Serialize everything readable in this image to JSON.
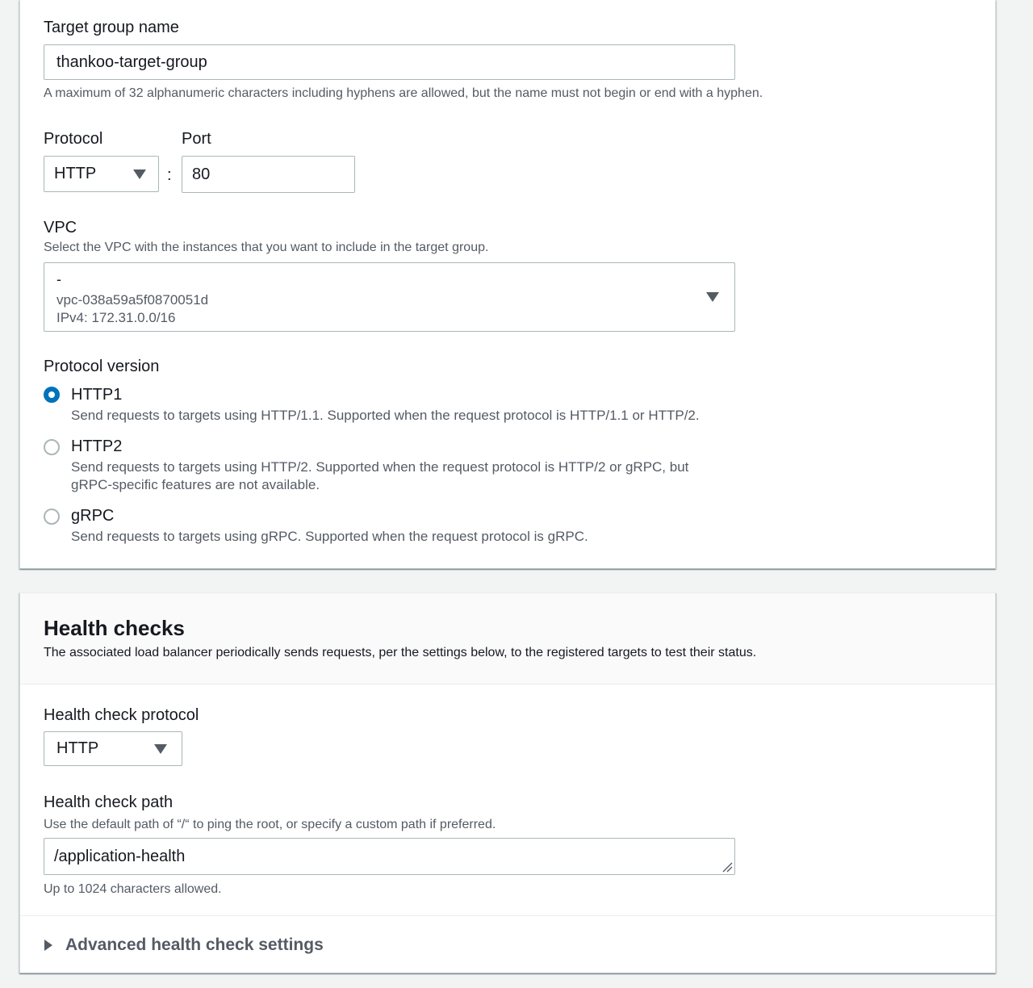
{
  "target_group": {
    "name_label": "Target group name",
    "name_value": "thankoo-target-group",
    "name_hint": "A maximum of 32 alphanumeric characters including hyphens are allowed, but the name must not begin or end with a hyphen."
  },
  "protocol": {
    "label": "Protocol",
    "value": "HTTP",
    "separator": ":"
  },
  "port": {
    "label": "Port",
    "value": "80"
  },
  "vpc": {
    "label": "VPC",
    "description": "Select the VPC with the instances that you want to include in the target group.",
    "selected_name": "-",
    "selected_id": "vpc-038a59a5f0870051d",
    "selected_cidr": "IPv4: 172.31.0.0/16"
  },
  "protocol_version": {
    "label": "Protocol version",
    "options": [
      {
        "title": "HTTP1",
        "description": "Send requests to targets using HTTP/1.1. Supported when the request protocol is HTTP/1.1 or HTTP/2.",
        "description2": "",
        "checked": true
      },
      {
        "title": "HTTP2",
        "description": "Send requests to targets using HTTP/2. Supported when the request protocol is HTTP/2 or gRPC, but",
        "description2": "gRPC-specific features are not available.",
        "checked": false
      },
      {
        "title": "gRPC",
        "description": "Send requests to targets using gRPC. Supported when the request protocol is gRPC.",
        "description2": "",
        "checked": false
      }
    ]
  },
  "health_checks": {
    "title": "Health checks",
    "description": "The associated load balancer periodically sends requests, per the settings below, to the registered targets to test their status.",
    "protocol_label": "Health check protocol",
    "protocol_value": "HTTP",
    "path_label": "Health check path",
    "path_description": "Use the default path of “/“ to ping the root, or specify a custom path if preferred.",
    "path_value": "/application-health",
    "path_hint": "Up to 1024 characters allowed.",
    "advanced_label": "Advanced health check settings"
  },
  "colors": {
    "accent": "#0073bb",
    "text": "#16191f",
    "muted": "#545b64",
    "border": "#aab7b8"
  }
}
